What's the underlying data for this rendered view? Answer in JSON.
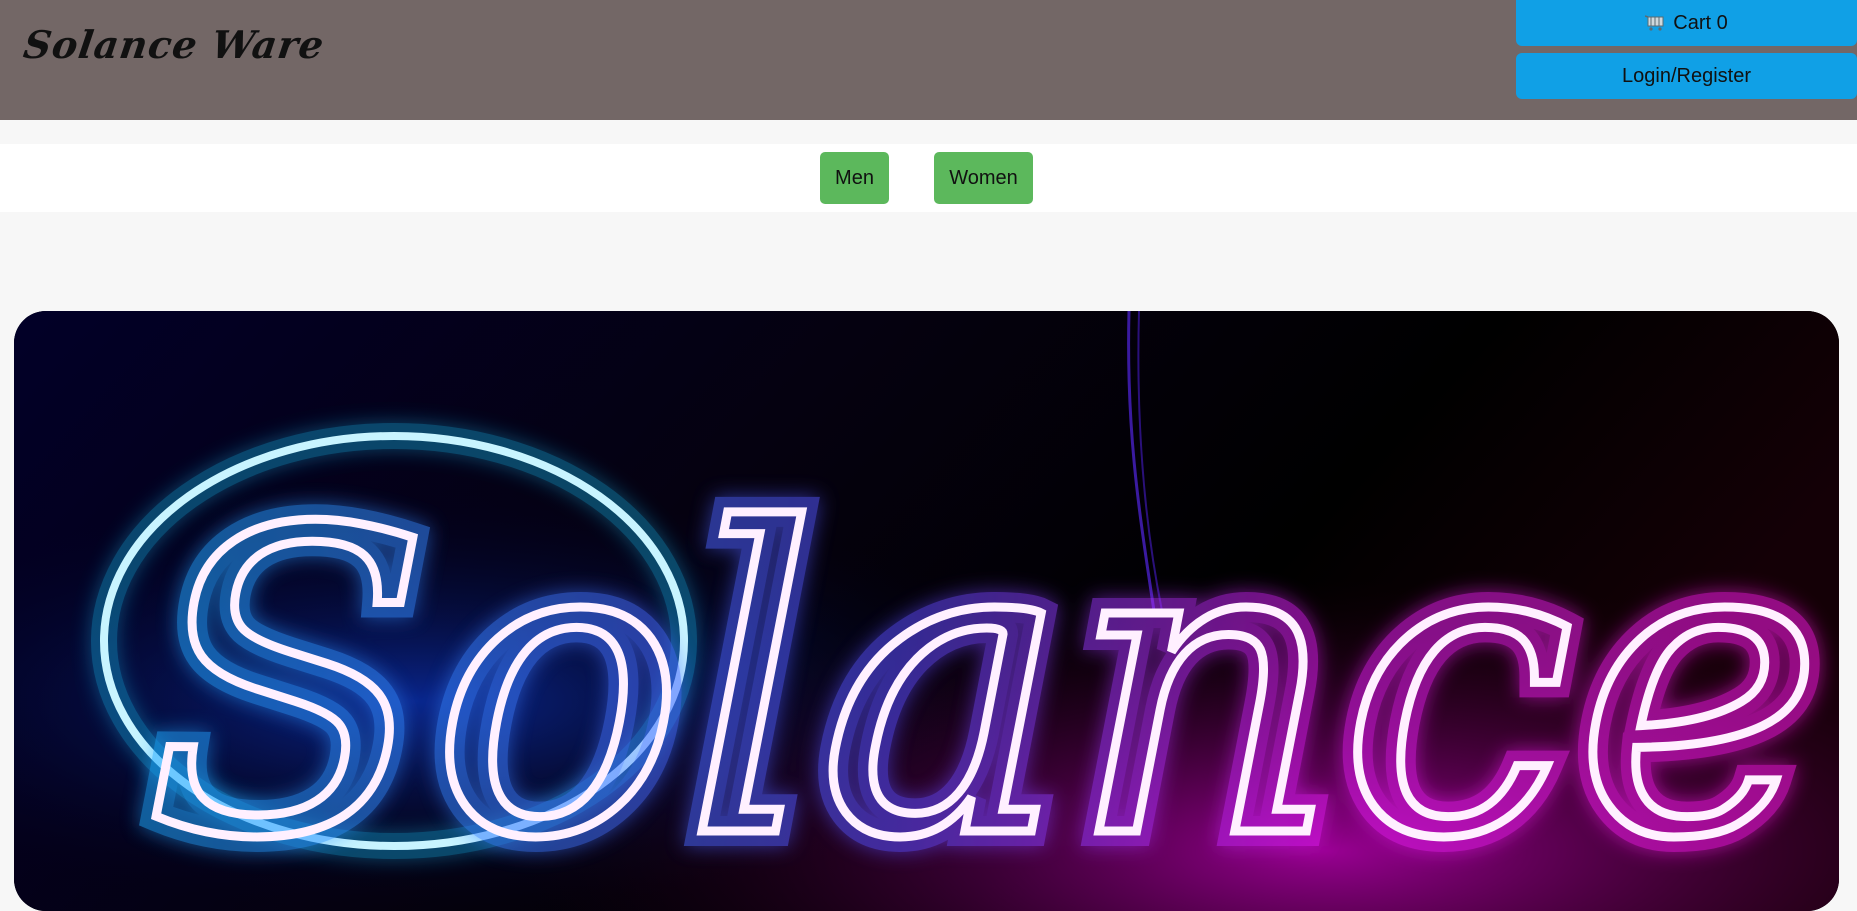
{
  "header": {
    "logo_text": "Solance Ware",
    "cart_label": "Cart 0",
    "cart_icon": "shopping-cart-icon",
    "login_label": "Login/Register"
  },
  "nav": {
    "items": [
      {
        "label": "Men"
      },
      {
        "label": "Women"
      }
    ]
  },
  "hero": {
    "neon_text": "Solance",
    "colors": {
      "background_left": "#020028",
      "background_right": "#140006",
      "neon_blue": "#16b4ff",
      "neon_pink": "#ff18f0"
    }
  },
  "colors": {
    "header_bg": "#736766",
    "header_button": "#10a0e6",
    "nav_button": "#5cb85c",
    "page_bg": "#f7f7f7"
  }
}
